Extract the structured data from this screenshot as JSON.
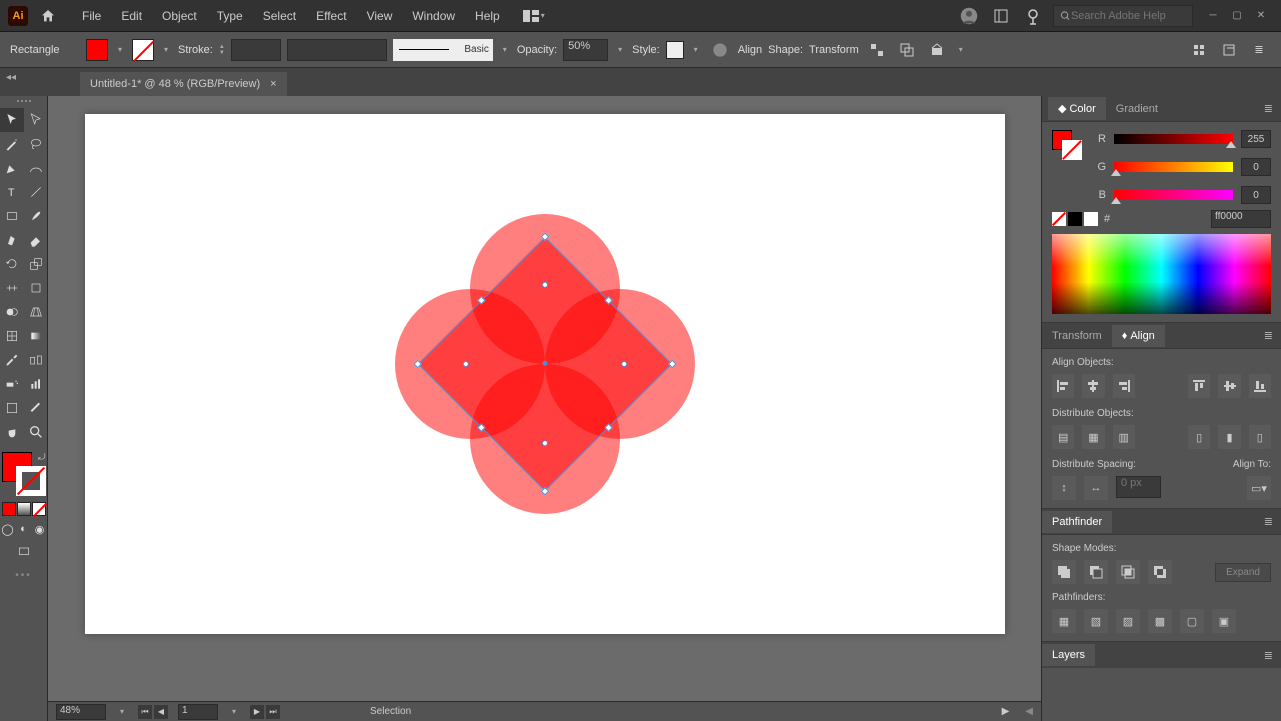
{
  "menubar": {
    "app_label": "Ai",
    "items": [
      "File",
      "Edit",
      "Object",
      "Type",
      "Select",
      "Effect",
      "View",
      "Window",
      "Help"
    ],
    "search_placeholder": "Search Adobe Help"
  },
  "controlbar": {
    "shape_name": "Rectangle",
    "stroke_label": "Stroke:",
    "brush_label": "Basic",
    "opacity_label": "Opacity:",
    "opacity_value": "50%",
    "style_label": "Style:",
    "align_label": "Align",
    "shape_label": "Shape:",
    "transform_label": "Transform"
  },
  "document": {
    "tab_title": "Untitled-1* @ 48 % (RGB/Preview)"
  },
  "statusbar": {
    "zoom": "48%",
    "artboard_num": "1",
    "tool": "Selection"
  },
  "panels": {
    "color": {
      "tab1": "Color",
      "tab2": "Gradient",
      "r_label": "R",
      "r_val": "255",
      "g_label": "G",
      "g_val": "0",
      "b_label": "B",
      "b_val": "0",
      "hex_prefix": "#",
      "hex_val": "ff0000"
    },
    "transform_align": {
      "tab1": "Transform",
      "tab2": "Align",
      "align_objects": "Align Objects:",
      "distribute_objects": "Distribute Objects:",
      "distribute_spacing": "Distribute Spacing:",
      "align_to": "Align To:",
      "spacing_val": "0 px"
    },
    "pathfinder": {
      "title": "Pathfinder",
      "shape_modes": "Shape Modes:",
      "pathfinders": "Pathfinders:",
      "expand": "Expand"
    },
    "layers": {
      "title": "Layers"
    }
  }
}
